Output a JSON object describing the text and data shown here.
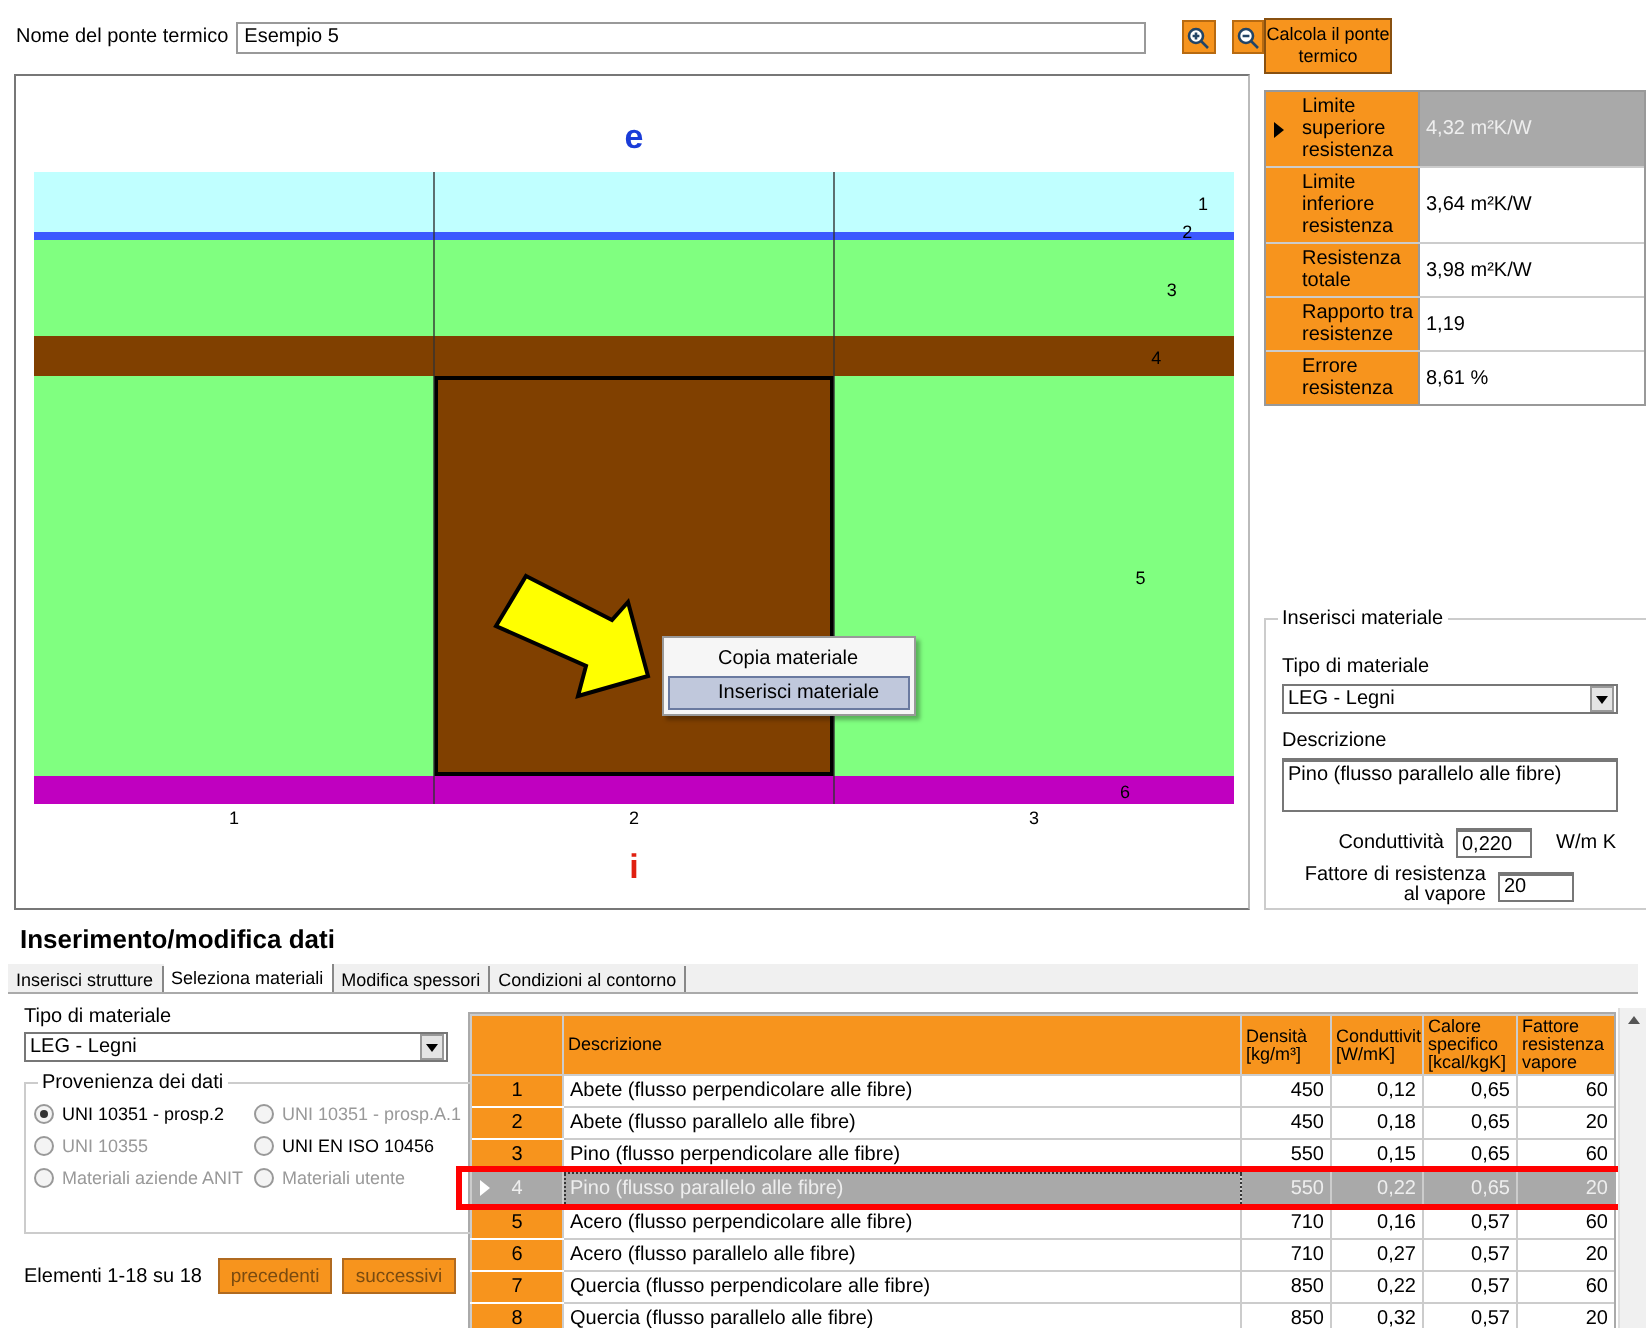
{
  "header": {
    "label": "Nome del ponte termico",
    "name_value": "Esempio 5"
  },
  "calculate_button": "Calcola il ponte termico",
  "diagram": {
    "exterior_label": "e",
    "interior_label": "i",
    "columns": [
      "1",
      "2",
      "3"
    ],
    "layers": [
      {
        "label": "1",
        "color": "#c0ffff"
      },
      {
        "label": "2",
        "color": "#3c5aff"
      },
      {
        "label": "3",
        "color": "#80ff80"
      },
      {
        "label": "4",
        "color": "#804000"
      },
      {
        "label": "5",
        "segments": [
          {
            "color": "#80ff80",
            "selected": false
          },
          {
            "color": "#804000",
            "selected": true
          },
          {
            "color": "#80ff80",
            "selected": false
          }
        ]
      },
      {
        "label": "6",
        "color": "#c000c0"
      }
    ]
  },
  "context_menu": [
    {
      "label": "Copia materiale",
      "selected": false
    },
    {
      "label": "Inserisci materiale",
      "selected": true
    }
  ],
  "results": [
    {
      "label": "Limite superiore resistenza",
      "value": "4,32 m²K/W",
      "selected": true
    },
    {
      "label": "Limite inferiore resistenza",
      "value": "3,64 m²K/W",
      "selected": false
    },
    {
      "label": "Resistenza totale",
      "value": "3,98 m²K/W",
      "selected": false
    },
    {
      "label": "Rapporto tra resistenze",
      "value": "1,19",
      "selected": false
    },
    {
      "label": "Errore resistenza",
      "value": "8,61 %",
      "selected": false
    }
  ],
  "insert_material": {
    "title": "Inserisci materiale",
    "type_label": "Tipo di materiale",
    "type_value": "LEG - Legni",
    "description_label": "Descrizione",
    "description_value": "Pino (flusso parallelo alle fibre)",
    "conductivity_label": "Conduttività",
    "conductivity_value": "0,220",
    "conductivity_unit": "W/m K",
    "vapour_label": "Fattore di resistenza al vapore",
    "vapour_value": "20"
  },
  "data_entry": {
    "title": "Inserimento/modifica dati",
    "tabs": [
      {
        "label": "Inserisci strutture",
        "selected": false
      },
      {
        "label": "Seleziona materiali",
        "selected": true
      },
      {
        "label": "Modifica spessori",
        "selected": false
      },
      {
        "label": "Condizioni al contorno",
        "selected": false
      }
    ],
    "material_type_label": "Tipo di materiale",
    "material_type_value": "LEG - Legni",
    "source": {
      "title": "Provenienza dei dati",
      "options": [
        {
          "label": "UNI 10351 - prosp.2",
          "checked": true,
          "disabled": false
        },
        {
          "label": "UNI 10351 - prosp.A.1",
          "checked": false,
          "disabled": true
        },
        {
          "label": "UNI 10355",
          "checked": false,
          "disabled": true
        },
        {
          "label": "UNI EN ISO 10456",
          "checked": false,
          "disabled": false
        },
        {
          "label": "Materiali aziende ANIT",
          "checked": false,
          "disabled": true
        },
        {
          "label": "Materiali utente",
          "checked": false,
          "disabled": true
        }
      ]
    },
    "count": "Elementi 1-18 su 18",
    "buttons": [
      "precedenti",
      "successivi"
    ],
    "table": {
      "columns": [
        "Descrizione",
        "Densità [kg/m³]",
        "Conduttivit [W/mK]",
        "Calore specifico [kcal/kgK]",
        "Fattore resistenza vapore"
      ],
      "rows": [
        {
          "number": "1",
          "cells": [
            "Abete (flusso perpendicolare alle fibre)",
            "450",
            "0,12",
            "0,65",
            "60"
          ],
          "selected": false
        },
        {
          "number": "2",
          "cells": [
            "Abete (flusso parallelo alle fibre)",
            "450",
            "0,18",
            "0,65",
            "20"
          ],
          "selected": false
        },
        {
          "number": "3",
          "cells": [
            "Pino (flusso perpendicolare alle fibre)",
            "550",
            "0,15",
            "0,65",
            "60"
          ],
          "selected": false
        },
        {
          "number": "4",
          "cells": [
            "Pino (flusso parallelo alle fibre)",
            "550",
            "0,22",
            "0,65",
            "20"
          ],
          "selected": true
        },
        {
          "number": "5",
          "cells": [
            "Acero (flusso perpendicolare alle fibre)",
            "710",
            "0,16",
            "0,57",
            "60"
          ],
          "selected": false
        },
        {
          "number": "6",
          "cells": [
            "Acero (flusso parallelo alle fibre)",
            "710",
            "0,27",
            "0,57",
            "20"
          ],
          "selected": false
        },
        {
          "number": "7",
          "cells": [
            "Quercia (flusso perpendicolare alle fibre)",
            "850",
            "0,22",
            "0,57",
            "60"
          ],
          "selected": false
        },
        {
          "number": "8",
          "cells": [
            "Quercia (flusso parallelo alle fibre)",
            "850",
            "0,32",
            "0,57",
            "20"
          ],
          "selected": false
        }
      ]
    }
  }
}
